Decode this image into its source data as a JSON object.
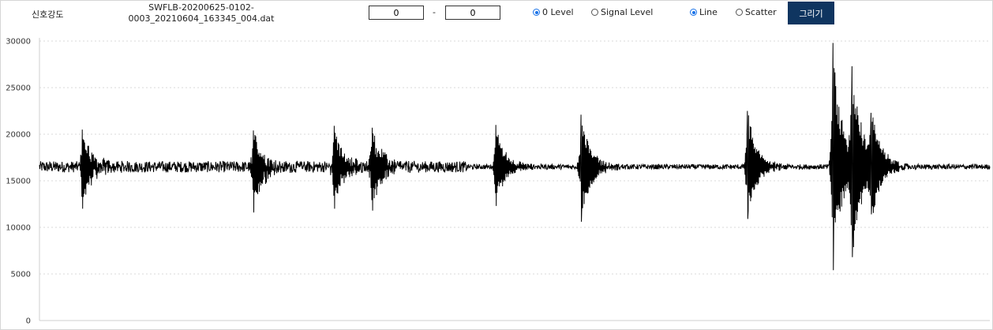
{
  "header": {
    "signal_label": "신호강도",
    "file_name_line1": "SWFLB-20200625-0102-",
    "file_name_line2": "0003_20210604_163345_004.dat",
    "range_start": "0",
    "range_sep": "-",
    "range_end": "0",
    "level_options": [
      {
        "label": "0 Level",
        "checked": true
      },
      {
        "label": "Signal Level",
        "checked": false
      }
    ],
    "plot_options": [
      {
        "label": "Line",
        "checked": true
      },
      {
        "label": "Scatter",
        "checked": false
      }
    ],
    "draw_button": "그리기"
  },
  "chart_data": {
    "type": "line",
    "title": "",
    "xlabel": "",
    "ylabel": "",
    "ylim": [
      0,
      30000
    ],
    "yticks": [
      0,
      5000,
      10000,
      15000,
      20000,
      25000,
      30000
    ],
    "grid": "horizontal dotted",
    "color": "#000000",
    "baseline": 16500,
    "noise_amplitude": 600,
    "n_samples": 2400,
    "bursts": [
      {
        "x": 0.045,
        "max": 20500,
        "min": 12000
      },
      {
        "x": 0.225,
        "max": 20400,
        "min": 11600
      },
      {
        "x": 0.31,
        "max": 20900,
        "min": 12000
      },
      {
        "x": 0.35,
        "max": 20700,
        "min": 11800
      },
      {
        "x": 0.48,
        "max": 21000,
        "min": 12300
      },
      {
        "x": 0.57,
        "max": 22100,
        "min": 10600
      },
      {
        "x": 0.745,
        "max": 22500,
        "min": 10900
      },
      {
        "x": 0.835,
        "max": 29800,
        "min": 5400
      },
      {
        "x": 0.855,
        "max": 27300,
        "min": 6800
      },
      {
        "x": 0.875,
        "max": 22300,
        "min": 11400
      }
    ]
  }
}
